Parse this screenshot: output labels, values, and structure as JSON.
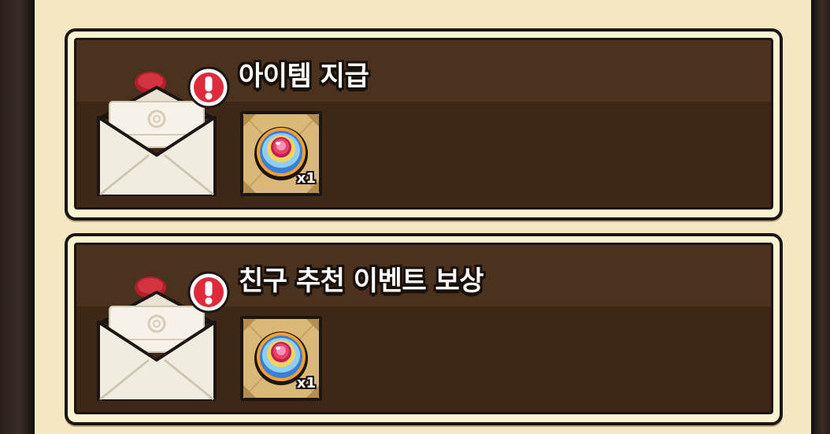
{
  "mailbox": {
    "mails": [
      {
        "title": "아이템 지급",
        "reward": {
          "item_icon": "gem-medallion-icon",
          "quantity": "x1"
        },
        "unread_alert": "!"
      },
      {
        "title": "친구 추천 이벤트 보상",
        "reward": {
          "item_icon": "gem-medallion-icon",
          "quantity": "x1"
        },
        "unread_alert": "!"
      }
    ]
  },
  "colors": {
    "card_dark": "#3d2818",
    "card_border": "#1c1511",
    "panel_cream": "#f4e8c4",
    "alert_red": "#e0293a",
    "gem_pink": "#e8436a"
  }
}
